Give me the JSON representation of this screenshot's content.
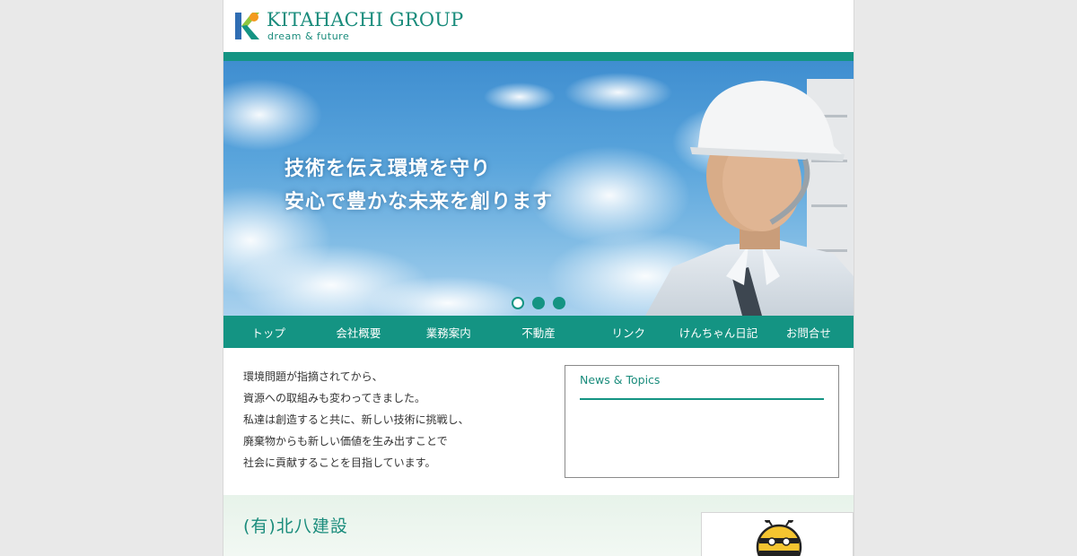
{
  "brand": {
    "name": "KITAHACHI GROUP",
    "tagline": "dream & future"
  },
  "hero": {
    "line1": "技術を伝え環境を守り",
    "line2": "安心で豊かな未来を創ります",
    "slides": 3,
    "active_slide": 1
  },
  "nav": [
    {
      "label": "トップ"
    },
    {
      "label": "会社概要"
    },
    {
      "label": "業務案内"
    },
    {
      "label": "不動産"
    },
    {
      "label": "リンク"
    },
    {
      "label": "けんちゃん日記"
    },
    {
      "label": "お問合せ"
    }
  ],
  "intro": {
    "lines": [
      "環境問題が指摘されてから、",
      "資源への取組みも変わってきました。",
      "私達は創造すると共に、新しい技術に挑戦し、",
      "廃棄物からも新しい価値を生み出すことで",
      "社会に貢献することを目指しています。"
    ]
  },
  "news": {
    "title": "News & Topics"
  },
  "company": {
    "name": "(有)北八建設"
  },
  "colors": {
    "accent": "#149483",
    "background": "#e9e9e9",
    "sky": "#5aa5dc"
  }
}
